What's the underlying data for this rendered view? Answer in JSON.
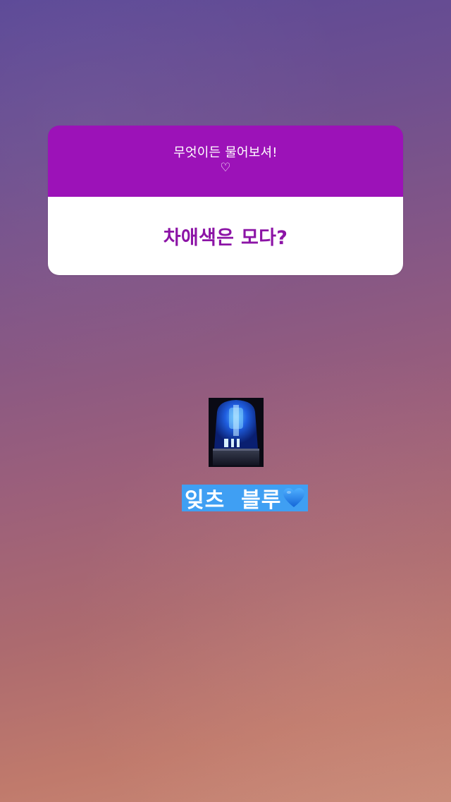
{
  "question_sticker": {
    "prompt": "무엇이든 물어보셔!",
    "heart": "♡",
    "answer": "차애색은 모다?"
  },
  "caption": {
    "text": "잊츠  블루"
  },
  "colors": {
    "header": "#9c12b8",
    "answer_text": "#8c14a6",
    "caption_highlight": "#3f9ff3",
    "heart_blue": "#1f86ea"
  },
  "icons": {
    "siren": "siren-light-icon",
    "blue_heart": "blue-heart-icon"
  }
}
